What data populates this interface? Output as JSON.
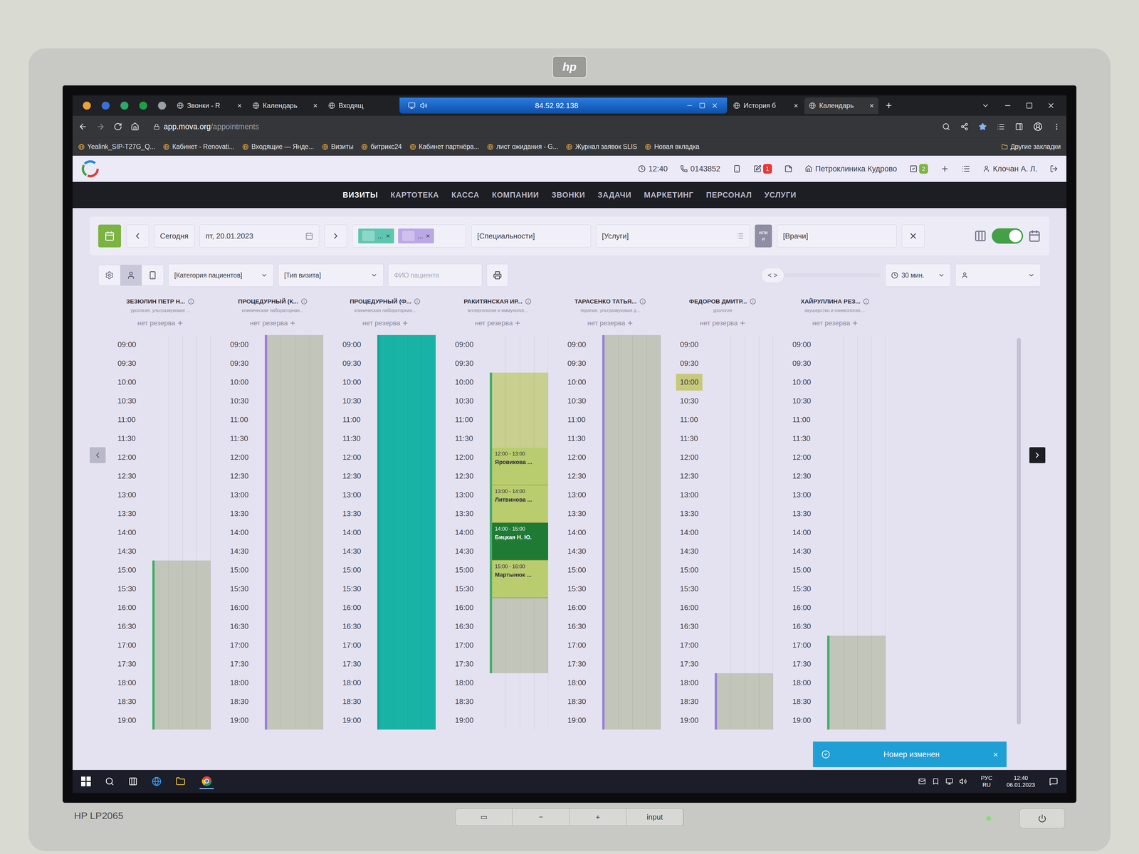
{
  "monitor": {
    "brand": "hp",
    "model": "HP LP2065",
    "buttons": [
      "▭",
      "−",
      "+",
      "input"
    ]
  },
  "browser": {
    "pinned_tabs": [
      {
        "color": "#e8a33d"
      },
      {
        "color": "#3b6fd8"
      },
      {
        "color": "#2fa86a"
      },
      {
        "color": "#1e9e4a"
      },
      {
        "color": "#9aa0a6"
      }
    ],
    "tabs": [
      {
        "label": "Звонки - R",
        "selected": false,
        "close": "×"
      },
      {
        "label": "Календарь",
        "selected": false,
        "close": "×"
      },
      {
        "label": "Входящ",
        "selected": false,
        "close": ""
      },
      {
        "label": "История б",
        "selected": false,
        "close": "×"
      },
      {
        "label": "Календарь",
        "selected": true,
        "close": "×"
      }
    ],
    "remote_bar": {
      "address": "84.52.92.138"
    },
    "new_tab": "+",
    "url": {
      "host": "app.mova.org",
      "path": "/appointments"
    },
    "bookmarks": [
      "Yealink_SIP-T27G_Q...",
      "Кабинет - Renovati...",
      "Входящие — Янде...",
      "Визиты",
      "битрикс24",
      "Кабинет партнёра...",
      "лист ожидания - G...",
      "Журнал заявок SLIS",
      "Новая вкладка"
    ],
    "other_bookmarks": "Другие закладки"
  },
  "app_header": {
    "time": "12:40",
    "phone": "0143852",
    "edit_badge": "1",
    "clinic": "Петроклиника Кудрово",
    "tasks_badge": "2",
    "user": "Клочан А. Л."
  },
  "nav": [
    {
      "label": "ВИЗИТЫ",
      "selected": true
    },
    {
      "label": "КАРТОТЕКА",
      "selected": false
    },
    {
      "label": "КАССА",
      "selected": false
    },
    {
      "label": "КОМПАНИИ",
      "selected": false
    },
    {
      "label": "ЗВОНКИ",
      "selected": false
    },
    {
      "label": "ЗАДАЧИ",
      "selected": false
    },
    {
      "label": "МАРКЕТИНГ",
      "selected": false
    },
    {
      "label": "ПЕРСОНАЛ",
      "selected": false
    },
    {
      "label": "УСЛУГИ",
      "selected": false
    }
  ],
  "toolbar": {
    "today": "Сегодня",
    "date": "пт, 20.01.2023",
    "chips": [
      {
        "label": "...",
        "close": "×",
        "color": "#5ec6b0"
      },
      {
        "label": "...",
        "close": "×",
        "color": "#b9a7e6"
      }
    ],
    "specialties": "[Специальности]",
    "services": "[Услуги]",
    "logic": [
      "или",
      "и"
    ],
    "doctors": "[Врачи]",
    "toggle_on": true
  },
  "filters": {
    "view_modes": [
      {
        "kind": "person",
        "selected": true
      },
      {
        "kind": "device",
        "selected": false
      }
    ],
    "category": "[Категория пациентов]",
    "visit_type": "[Тип визита]",
    "patient_placeholder": "ФИО пациента",
    "zoom": "< >",
    "interval": "30 мин."
  },
  "times": [
    "09:00",
    "09:30",
    "10:00",
    "10:30",
    "11:00",
    "11:30",
    "12:00",
    "12:30",
    "13:00",
    "13:30",
    "14:00",
    "14:30",
    "15:00",
    "15:30",
    "16:00",
    "16:30",
    "17:00",
    "17:30",
    "18:00",
    "18:30",
    "19:00"
  ],
  "columns": [
    {
      "name": "ЗЕЗЮЛИН ПЕТР Н...",
      "subtitle": "урология, ультразвуковая ...",
      "reserve": "нет резерва",
      "add": "+",
      "color": "#3fae6a",
      "selected_time": "",
      "slots": [
        "free",
        "free",
        "free",
        "free",
        "free",
        "free",
        "free",
        "free",
        "free",
        "free",
        "free",
        "free",
        "off",
        "off",
        "off",
        "off",
        "off",
        "off",
        "off",
        "off",
        "off"
      ],
      "appointments": []
    },
    {
      "name": "ПРОЦЕДУРНЫЙ (К...",
      "subtitle": "клиническая лабораторная...",
      "reserve": "нет резерва",
      "add": "+",
      "color": "#9b7fd8",
      "selected_time": "",
      "slots": [
        "off",
        "off",
        "off",
        "off",
        "off",
        "off",
        "off",
        "off",
        "off",
        "off",
        "off",
        "off",
        "off",
        "off",
        "off",
        "off",
        "off",
        "off",
        "off",
        "off",
        "off"
      ],
      "appointments": []
    },
    {
      "name": "ПРОЦЕДУРНЫЙ (Ф...",
      "subtitle": "клиническая лабораторная...",
      "reserve": "нет резерва",
      "add": "+",
      "color": "#14a396",
      "selected_time": "",
      "slots": [
        "lab",
        "lab",
        "lab",
        "lab",
        "lab",
        "lab",
        "lab",
        "lab",
        "lab",
        "lab",
        "lab",
        "lab",
        "lab",
        "lab",
        "lab",
        "lab",
        "lab",
        "lab",
        "lab",
        "lab",
        "lab"
      ],
      "appointments": []
    },
    {
      "name": "РАКИТЯНСКАЯ ИР...",
      "subtitle": "аллергология и иммунолог...",
      "reserve": "нет резерва",
      "add": "+",
      "color": "#3fae6a",
      "selected_time": "",
      "slots": [
        "free",
        "free",
        "open",
        "open",
        "open",
        "open",
        "busy",
        "busy",
        "busy",
        "busy",
        "busy",
        "busy",
        "busy",
        "busy",
        "off",
        "off",
        "off",
        "off",
        "free",
        "free",
        "free"
      ],
      "appointments": [
        {
          "time": "12:00 - 13:00",
          "patient": "Яровикова ...",
          "color": "#b9cc6e"
        },
        {
          "time": "13:00 - 14:00",
          "patient": "Литвинова ...",
          "color": "#b9cc6e"
        },
        {
          "time": "14:00 - 15:00",
          "patient": "Бицкая Н. Ю.",
          "color": "#1f7a34"
        },
        {
          "time": "15:00 - 16:00",
          "patient": "Мартынюк ...",
          "color": "#b9cc6e"
        }
      ]
    },
    {
      "name": "ТАРАСЕНКО ТАТЬЯ...",
      "subtitle": "терапия, ультразвуковая д...",
      "reserve": "нет резерва",
      "add": "+",
      "color": "#9b7fd8",
      "selected_time": "",
      "slots": [
        "off",
        "off",
        "off",
        "off",
        "off",
        "off",
        "off",
        "off",
        "off",
        "off",
        "off",
        "off",
        "off",
        "off",
        "off",
        "off",
        "off",
        "off",
        "off",
        "off",
        "off"
      ],
      "appointments": []
    },
    {
      "name": "ФЕДОРОВ ДМИТР...",
      "subtitle": "урология",
      "reserve": "нет резерва",
      "add": "+",
      "color": "#9b7fd8",
      "selected_time": "10:00",
      "slots": [
        "free",
        "free",
        "free",
        "free",
        "free",
        "free",
        "free",
        "free",
        "free",
        "free",
        "free",
        "free",
        "free",
        "free",
        "free",
        "free",
        "free",
        "free",
        "off",
        "off",
        "off"
      ],
      "appointments": []
    },
    {
      "name": "ХАЙРУЛЛИНА РЕЗ...",
      "subtitle": "акушерство и гинекология,...",
      "reserve": "нет резерва",
      "add": "+",
      "color": "#3fae6a",
      "selected_time": "",
      "slots": [
        "free",
        "free",
        "free",
        "free",
        "free",
        "free",
        "free",
        "free",
        "free",
        "free",
        "free",
        "free",
        "free",
        "free",
        "free",
        "free",
        "off",
        "off",
        "off",
        "off",
        "off"
      ],
      "appointments": []
    }
  ],
  "toast": {
    "text": "Номер изменен",
    "close": "×"
  },
  "taskbar": {
    "language": "РУС",
    "layout": "RU",
    "time": "12:40",
    "date": "06.01.2023"
  }
}
